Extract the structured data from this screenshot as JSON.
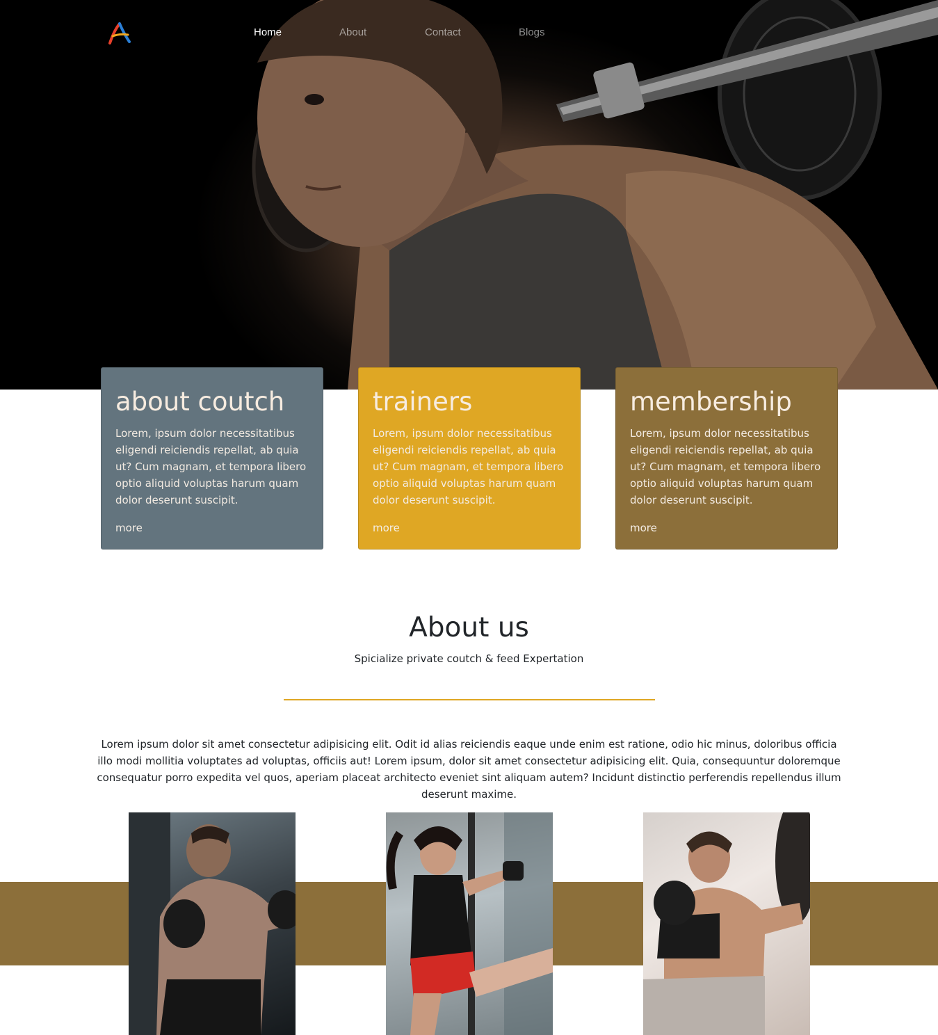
{
  "nav": {
    "items": [
      "Home",
      "About",
      "Contact",
      "Blogs"
    ],
    "active": "Home"
  },
  "cards": [
    {
      "title": "about coutch",
      "text": "Lorem, ipsum dolor necessitatibus eligendi reiciendis repellat, ab quia ut? Cum magnam, et tempora libero optio aliquid voluptas harum quam dolor deserunt suscipit.",
      "link": "more",
      "color": "#63747e"
    },
    {
      "title": "trainers",
      "text": "Lorem, ipsum dolor necessitatibus eligendi reiciendis repellat, ab quia ut? Cum magnam, et tempora libero optio aliquid voluptas harum quam dolor deserunt suscipit.",
      "link": "more",
      "color": "#dfa724"
    },
    {
      "title": "membership",
      "text": "Lorem, ipsum dolor necessitatibus eligendi reiciendis repellat, ab quia ut? Cum magnam, et tempora libero optio aliquid voluptas harum quam dolor deserunt suscipit.",
      "link": "more",
      "color": "#8c6f3a"
    }
  ],
  "about": {
    "title": "About us",
    "subtitle": "Spicialize private coutch & feed Expertation",
    "body": "Lorem ipsum dolor sit amet consectetur adipisicing elit. Odit id alias reiciendis eaque unde enim est ratione, odio hic minus, doloribus officia illo modi mollitia voluptates ad voluptas, officiis aut! Lorem ipsum, dolor sit amet consectetur adipisicing elit. Quia, consequuntur doloremque consequatur porro expedita vel quos, aperiam placeat architecto eveniet sint aliquam autem? Incidunt distinctio perferendis repellendus illum deserunt maxime.",
    "divider_color": "#dfa724"
  },
  "colors": {
    "accent_gold": "#dfa724",
    "accent_brown": "#8c6f3a",
    "slate": "#63747e"
  },
  "icons": [
    "logo-icon"
  ]
}
